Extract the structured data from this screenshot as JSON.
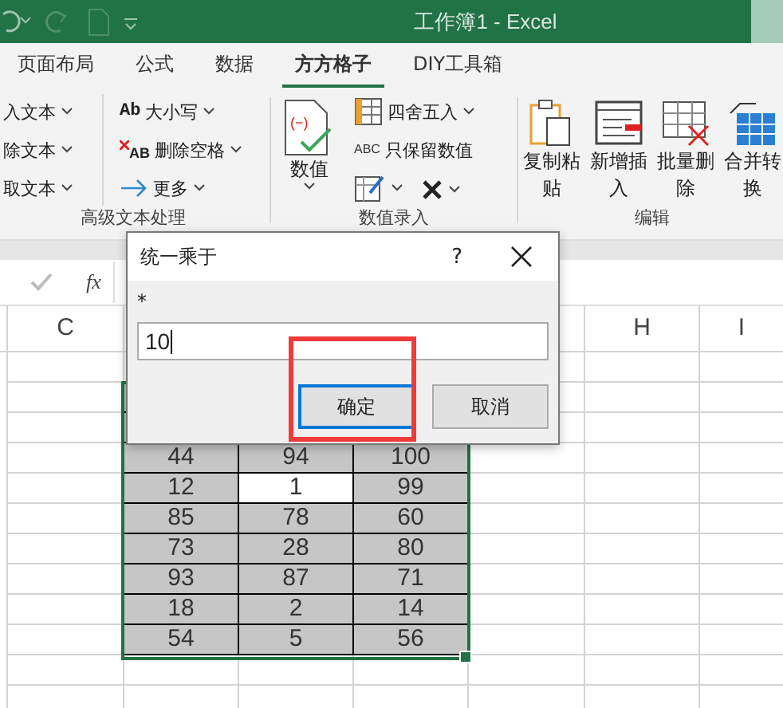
{
  "window": {
    "title": "工作簿1  -  Excel"
  },
  "tabs": [
    {
      "label": "页面布局",
      "selected": false
    },
    {
      "label": "公式",
      "selected": false
    },
    {
      "label": "数据",
      "selected": false
    },
    {
      "label": "方方格子",
      "selected": true
    },
    {
      "label": "DIY工具箱",
      "selected": false
    }
  ],
  "ribbon": {
    "groups": [
      {
        "label": "高级文本处理",
        "columns": [
          [
            {
              "label": "入文本"
            },
            {
              "label": "除文本"
            },
            {
              "label": "取文本"
            }
          ],
          [
            {
              "label": "大小写",
              "icon_text": "Ab"
            },
            {
              "label": "删除空格",
              "icon_text": "AB"
            },
            {
              "label": "更多"
            }
          ]
        ]
      },
      {
        "label": "数值录入",
        "big": [
          {
            "label": "数值",
            "icon_text": "(−)"
          }
        ],
        "small": [
          {
            "label": "四舍五入",
            "dropdown": true
          },
          {
            "label": "只保留数值",
            "icon_text": "ABC",
            "dropdown": false
          },
          {
            "dropdown": true
          }
        ]
      },
      {
        "label": "编辑",
        "big": [
          {
            "label": "复制粘贴"
          },
          {
            "label": "新增插入"
          },
          {
            "label": "批量删除"
          },
          {
            "label": "合并转换"
          }
        ]
      }
    ]
  },
  "formula_bar": {
    "function_label": "fx"
  },
  "columns": [
    {
      "label": "C"
    },
    {
      "label": "H"
    },
    {
      "label": "I"
    }
  ],
  "table": {
    "rows": [
      [
        {
          "value": "44",
          "active": false
        },
        {
          "value": "94",
          "active": false
        },
        {
          "value": "100",
          "active": false
        }
      ],
      [
        {
          "value": "12",
          "active": false
        },
        {
          "value": "1",
          "active": true
        },
        {
          "value": "99",
          "active": false
        }
      ],
      [
        {
          "value": "85",
          "active": false
        },
        {
          "value": "78",
          "active": false
        },
        {
          "value": "60",
          "active": false
        }
      ],
      [
        {
          "value": "73",
          "active": false
        },
        {
          "value": "28",
          "active": false
        },
        {
          "value": "80",
          "active": false
        }
      ],
      [
        {
          "value": "93",
          "active": false
        },
        {
          "value": "87",
          "active": false
        },
        {
          "value": "71",
          "active": false
        }
      ],
      [
        {
          "value": "18",
          "active": false
        },
        {
          "value": "2",
          "active": false
        },
        {
          "value": "14",
          "active": false
        }
      ],
      [
        {
          "value": "54",
          "active": false
        },
        {
          "value": "5",
          "active": false
        },
        {
          "value": "56",
          "active": false
        }
      ]
    ]
  },
  "dialog": {
    "title": "统一乘于",
    "help": "?",
    "field_label": "*",
    "value": "10",
    "buttons": [
      {
        "label": "确定",
        "default": true,
        "highlighted": true
      },
      {
        "label": "取消",
        "default": false,
        "highlighted": false
      }
    ]
  }
}
